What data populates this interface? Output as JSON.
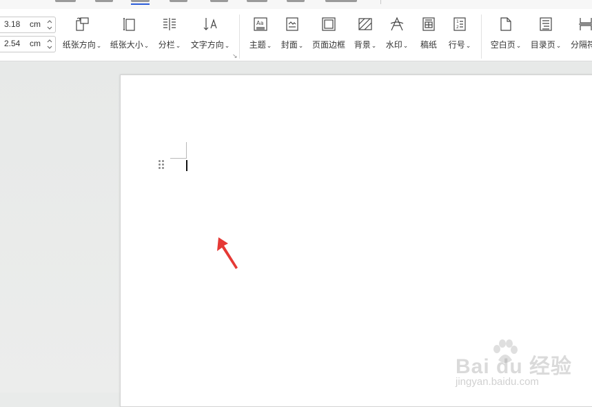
{
  "ribbon": {
    "margins": [
      {
        "value": "3.18",
        "unit": "cm"
      },
      {
        "value": "2.54",
        "unit": "cm"
      }
    ],
    "buttons": [
      {
        "label": "纸张方向",
        "caret": true,
        "icon": "paper-orientation-icon"
      },
      {
        "label": "纸张大小",
        "caret": true,
        "icon": "paper-size-icon"
      },
      {
        "label": "分栏",
        "caret": true,
        "icon": "columns-icon"
      },
      {
        "label": "文字方向",
        "caret": true,
        "icon": "text-direction-icon"
      },
      {
        "label": "主题",
        "caret": true,
        "icon": "theme-icon"
      },
      {
        "label": "封面",
        "caret": true,
        "icon": "cover-icon"
      },
      {
        "label": "页面边框",
        "caret": false,
        "icon": "page-border-icon"
      },
      {
        "label": "背景",
        "caret": true,
        "icon": "background-icon"
      },
      {
        "label": "水印",
        "caret": true,
        "icon": "watermark-icon"
      },
      {
        "label": "稿纸",
        "caret": false,
        "icon": "manuscript-paper-icon"
      },
      {
        "label": "行号",
        "caret": true,
        "icon": "line-number-icon"
      },
      {
        "label": "空白页",
        "caret": true,
        "icon": "blank-page-icon"
      },
      {
        "label": "目录页",
        "caret": true,
        "icon": "toc-page-icon"
      },
      {
        "label": "分隔符",
        "caret": false,
        "icon": "separator-icon"
      }
    ],
    "dropdown_caret": "⌄",
    "launcher_glyph": "↘"
  },
  "watermark": {
    "brand": "Bai du 经验",
    "url": "jingyan.baidu.com"
  },
  "colors": {
    "accent": "#2a5bd7",
    "arrow": "#e53935"
  }
}
